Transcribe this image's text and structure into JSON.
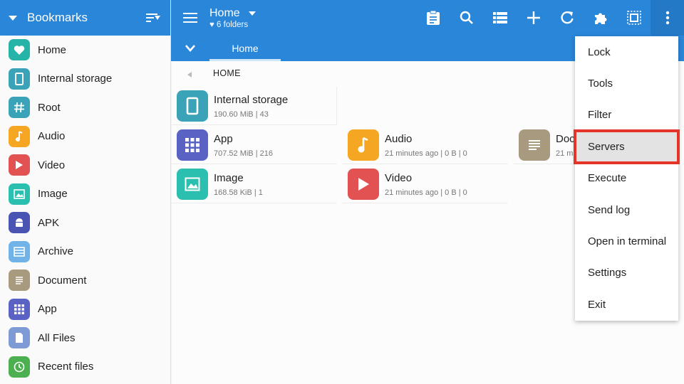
{
  "sidebar": {
    "title": "Bookmarks",
    "items": [
      {
        "label": "Home",
        "icon": "heart-icon",
        "color": "#26b3a8"
      },
      {
        "label": "Internal storage",
        "icon": "phone-icon",
        "color": "#3aa3b8"
      },
      {
        "label": "Root",
        "icon": "hash-icon",
        "color": "#3aa3b8"
      },
      {
        "label": "Audio",
        "icon": "music-note-icon",
        "color": "#f5a623"
      },
      {
        "label": "Video",
        "icon": "play-icon",
        "color": "#e25252"
      },
      {
        "label": "Image",
        "icon": "image-icon",
        "color": "#2bbfb0"
      },
      {
        "label": "APK",
        "icon": "android-icon",
        "color": "#4a55b3"
      },
      {
        "label": "Archive",
        "icon": "archive-icon",
        "color": "#6fb3e8"
      },
      {
        "label": "Document",
        "icon": "document-icon",
        "color": "#a89a7e"
      },
      {
        "label": "App",
        "icon": "grid-icon",
        "color": "#5a62c4"
      },
      {
        "label": "All Files",
        "icon": "file-icon",
        "color": "#7f9bd6"
      },
      {
        "label": "Recent files",
        "icon": "clock-icon",
        "color": "#4caf50"
      }
    ]
  },
  "header": {
    "title": "Home",
    "subtitle": "6 folders",
    "tab": "Home",
    "breadcrumb": "HOME"
  },
  "tiles": [
    {
      "name": "Internal storage",
      "meta": "190.60 MiB | 43",
      "icon": "phone-icon",
      "color": "#3aa3b8"
    },
    {
      "name": "App",
      "meta": "707.52 MiB | 216",
      "icon": "grid-icon",
      "color": "#5a62c4"
    },
    {
      "name": "Audio",
      "meta": "21 minutes ago | 0 B | 0",
      "icon": "music-note-icon",
      "color": "#f5a623"
    },
    {
      "name": "Doc",
      "meta": "21 m",
      "icon": "document-icon",
      "color": "#a89a7e"
    },
    {
      "name": "Image",
      "meta": "168.58  KiB | 1",
      "icon": "image-icon",
      "color": "#2bbfb0"
    },
    {
      "name": "Video",
      "meta": "21 minutes ago | 0 B | 0",
      "icon": "play-icon",
      "color": "#e25252"
    }
  ],
  "menu": {
    "items": [
      "Lock",
      "Tools",
      "Filter",
      "Servers",
      "Execute",
      "Send log",
      "Open in terminal",
      "Settings",
      "Exit"
    ],
    "highlighted": "Servers"
  },
  "colors": {
    "accent": "#2a86d9",
    "highlight_outline": "#e5352b"
  }
}
